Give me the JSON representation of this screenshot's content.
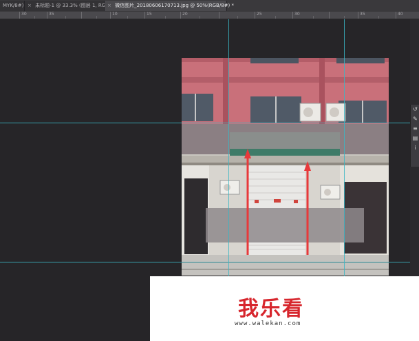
{
  "tabs": [
    {
      "label": "MYK/8#)",
      "close": "×"
    },
    {
      "label": "未标题-1 @ 33.3% (图层 1, RGB/8) *",
      "close": "×"
    },
    {
      "label": "微信图片_20180606170713.jpg @ 50%(RGB/8#) *",
      "close": "×"
    }
  ],
  "ruler": {
    "labels": [
      "30",
      "",
      "35",
      "",
      "10",
      "15",
      "20",
      "25",
      "30",
      "35",
      "40"
    ]
  },
  "side_panel": {
    "icons": [
      "rotate-icon",
      "brush-icon",
      "adjust-icon",
      "layers-icon",
      "info-icon"
    ],
    "glyphs": [
      "↺",
      "✎",
      "≡",
      "▤",
      "i"
    ]
  },
  "watermark": {
    "title": "我乐看",
    "url": "www.walekan.com"
  },
  "colors": {
    "guide": "#3bb6c4",
    "canvas": "#262528",
    "accent_red": "#d7262d"
  }
}
